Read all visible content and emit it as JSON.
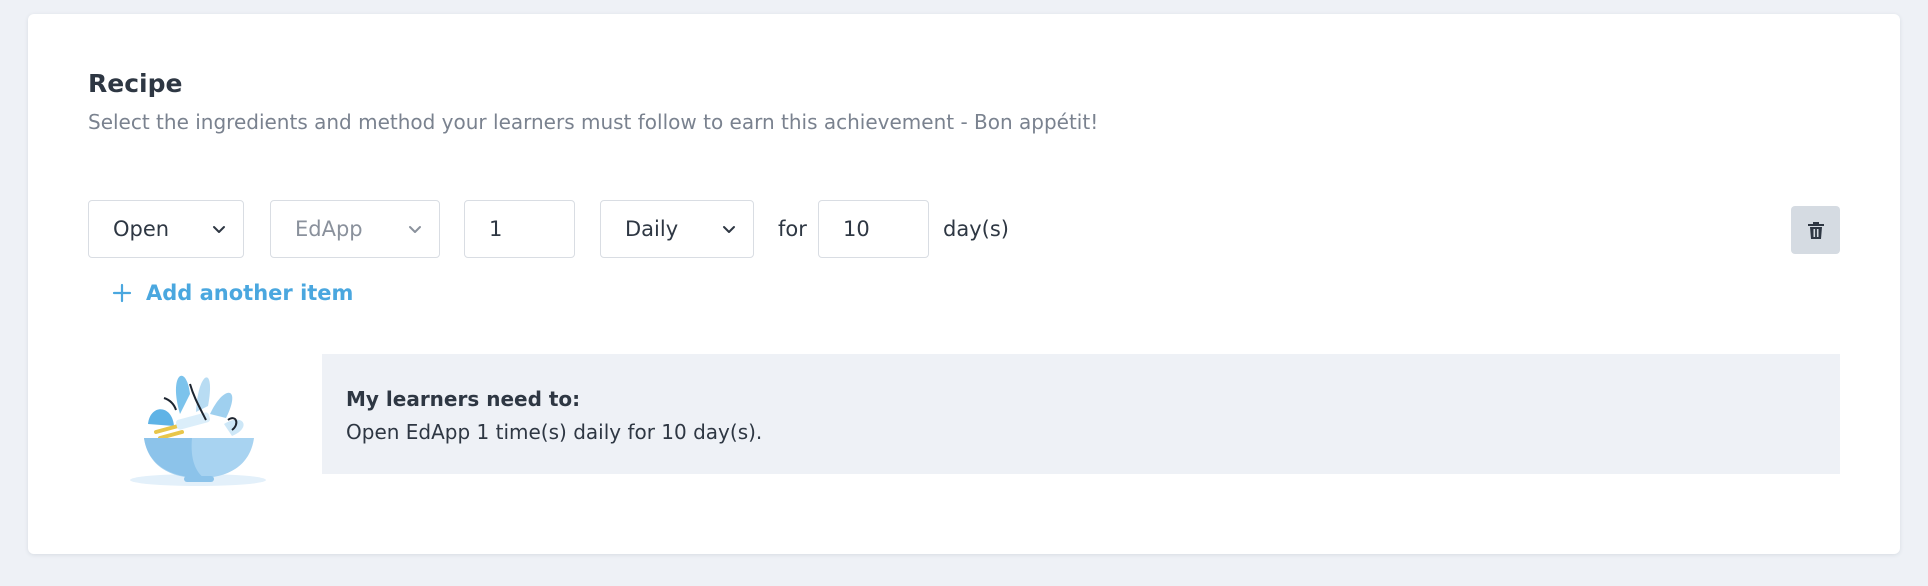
{
  "recipe": {
    "title": "Recipe",
    "subtitle": "Select the ingredients and method your learners must follow to earn this achievement - Bon appétit!"
  },
  "rule": {
    "action_select": {
      "value": "Open",
      "icon": "chevron-down-icon"
    },
    "target_select": {
      "value": "EdApp",
      "icon": "chevron-down-icon"
    },
    "count_input": {
      "value": "1"
    },
    "frequency_select": {
      "value": "Daily",
      "icon": "chevron-down-icon"
    },
    "for_label": "for",
    "duration_input": {
      "value": "10"
    },
    "duration_unit": "day(s)",
    "delete_icon": "trash-icon"
  },
  "add_item": {
    "icon": "plus-icon",
    "label": "Add another item"
  },
  "summary": {
    "illustration": "recipe-bowl-illustration",
    "heading": "My learners need to:",
    "text": "Open EdApp 1 time(s) daily for 10 day(s)."
  },
  "colors": {
    "page_background": "#eef1f6",
    "card_background": "#ffffff",
    "accent_link": "#4aa7df",
    "summary_background": "#eef1f6",
    "delete_button": "#d5dbe2"
  }
}
